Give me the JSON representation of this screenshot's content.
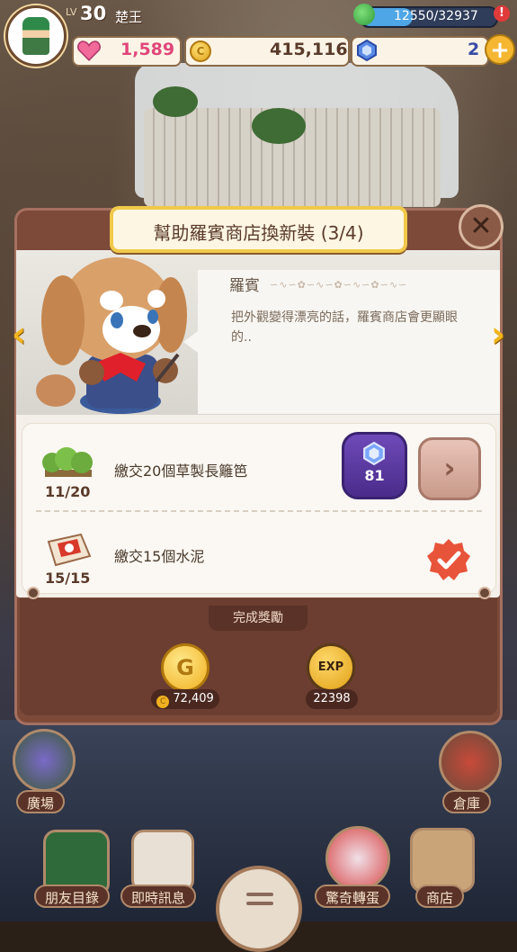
{
  "player": {
    "level_label": "LV",
    "level": "30",
    "name": "楚王"
  },
  "energy": {
    "text": "12550/32937",
    "progress": 0.381,
    "alert": "!"
  },
  "resources": {
    "hearts": "1,589",
    "coins": "415,116",
    "coin_symbol": "C",
    "gems": "2",
    "plus": "+"
  },
  "quest": {
    "title": "幫助羅賓商店換新裝 (3/4)",
    "close": "✕",
    "prev_arrow": "‹",
    "next_arrow": "›",
    "npc_name": "羅賓",
    "ornament": "∽∿∽✿∽∿∽✿∽∿∽✿∽∿∽",
    "description": "把外觀變得漂亮的話，羅賓商店會更顯眼的..",
    "tasks": [
      {
        "count": "11/20",
        "text": "繳交20個草製長籬笆",
        "gem_cost": "81",
        "go": "›",
        "icon": "hedge-icon"
      },
      {
        "count": "15/15",
        "text": "繳交15個水泥",
        "icon": "cement-icon",
        "status": "completed"
      }
    ],
    "rewards_label": "完成獎勵",
    "rewards": {
      "gold_symbol": "G",
      "gold_amount": "72,409",
      "exp_symbol": "EXP",
      "exp_amount": "22398"
    }
  },
  "nav": {
    "plaza": "廣場",
    "warehouse": "倉庫",
    "friends": "朋友目錄",
    "messages": "即時訊息",
    "gacha": "驚奇轉蛋",
    "shop": "商店"
  },
  "colors": {
    "dialog_frame": "#7d4a3a",
    "title_border": "#f0c94a",
    "gem_button": "#5a38a0",
    "accent_gold": "#f2b51c"
  }
}
